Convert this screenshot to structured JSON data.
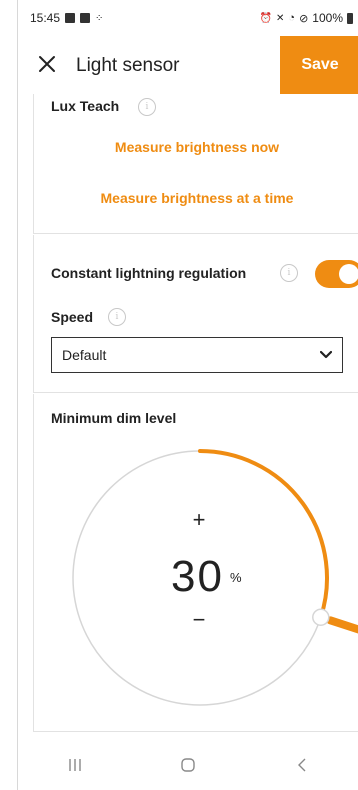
{
  "status_bar": {
    "time": "15:45",
    "battery": "100%"
  },
  "app_bar": {
    "title": "Light sensor",
    "save_label": "Save"
  },
  "lux_teach": {
    "label": "Lux Teach",
    "measure_now": "Measure brightness now",
    "measure_at_time": "Measure brightness at a time"
  },
  "regulation": {
    "label": "Constant lightning regulation",
    "enabled": true,
    "speed_label": "Speed",
    "speed_value": "Default"
  },
  "dim": {
    "label": "Minimum dim level",
    "value": "30",
    "unit": "%",
    "plus": "+",
    "minus": "−",
    "level_fraction": 0.3
  },
  "colors": {
    "accent": "#ef8c12",
    "text": "#222222",
    "ring": "#d6d6d6"
  },
  "icons": {
    "close": "close-icon",
    "info": "info-icon",
    "chevron": "chevron-down-icon",
    "nav_recents": "recents-icon",
    "nav_home": "home-icon",
    "nav_back": "back-icon"
  }
}
